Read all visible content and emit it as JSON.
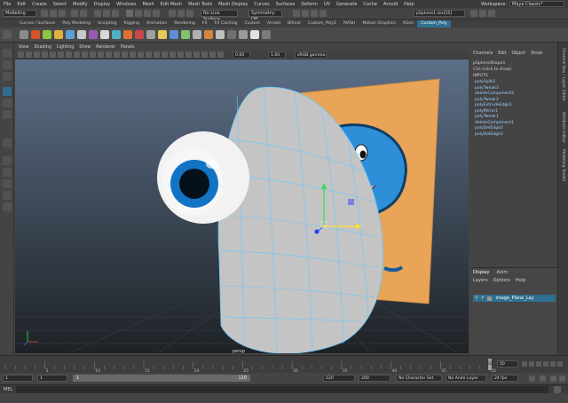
{
  "menubar": {
    "items": [
      "File",
      "Edit",
      "Create",
      "Select",
      "Modify",
      "Display",
      "Windows",
      "Mesh",
      "Edit Mesh",
      "Mesh Tools",
      "Mesh Display",
      "Curves",
      "Surfaces",
      "Deform",
      "UV",
      "Generate",
      "Cache",
      "Arnold",
      "Help"
    ],
    "workspace_label": "Workspace:",
    "workspace_value": "Maya Classic*"
  },
  "status": {
    "mode": "Modeling",
    "live_surface": "No Live Surface",
    "symmetry": "Symmetry: Off",
    "selection": "pSphere1.vtx[55]"
  },
  "shelf_tabs": {
    "items": [
      "Curves / Surfaces",
      "Poly Modeling",
      "Sculpting",
      "Rigging",
      "Animation",
      "Rendering",
      "FX",
      "FX Caching",
      "Custom",
      "Arnold",
      "Bifrost",
      "Custom_Poly1",
      "MASH",
      "Motion Graphics",
      "XGen",
      "Custom_Poly"
    ],
    "active_index": 15
  },
  "shelf_icon_colors": [
    "#8a8a8a",
    "#d8542c",
    "#8ec63f",
    "#e0b040",
    "#5aa0d8",
    "#c8c8c8",
    "#9b59b6",
    "#d8d8d8",
    "#4fb0c6",
    "#e07030",
    "#c84848",
    "#a0a0a0",
    "#e8c85a",
    "#5c8fd6",
    "#7fc16e",
    "#b0b0b0",
    "#d6863c",
    "#c0c0c0",
    "#707070",
    "#9c9c9c",
    "#e2e2e2",
    "#7a7a7a"
  ],
  "viewport": {
    "menu": [
      "View",
      "Shading",
      "Lighting",
      "Show",
      "Renderer",
      "Panels"
    ],
    "exposure": "0.00",
    "gamma": "1.00",
    "color_space": "sRGB gamma",
    "camera_label": "persp",
    "bg_top": "#5c6f88",
    "bg_bottom": "#1e2226",
    "mesh_color": "#c4c4c4",
    "wire_color": "#66c8ff",
    "plane_color": "#e9a458",
    "eye_iris_color": "#1274c4"
  },
  "channel_box": {
    "tabs": [
      "Channels",
      "Edit",
      "Object",
      "Show"
    ],
    "shape": "pSphereShape1",
    "cvs": "CVs (click to show)",
    "inputs_label": "INPUTS",
    "history": [
      "polySplit3",
      "polyTweak3",
      "deleteComponent2",
      "polyTweak2",
      "polyExtrudeEdge1",
      "polyMirror1",
      "polyTweak1",
      "deleteComponent1",
      "polyDelEdge2",
      "polyDelEdge1"
    ],
    "side_tabs": [
      "Channel Box / Layer Editor",
      "Attribute Editor",
      "Modeling Toolkit"
    ]
  },
  "layer_editor": {
    "tabs": [
      "Display",
      "Anim"
    ],
    "menu": [
      "Layers",
      "Options",
      "Help"
    ],
    "layer_v": "V",
    "layer_p": "P",
    "layer_name": "image_Plane_Lay"
  },
  "time_slider": {
    "ticks": [
      "5",
      "10",
      "15",
      "20",
      "25",
      "30",
      "35",
      "40",
      "45",
      "50"
    ],
    "current_frame": "50",
    "current_time_field": "50"
  },
  "range_slider": {
    "start": "1",
    "start2": "1",
    "range_start_label": "1",
    "range_end_label": "120",
    "end": "120",
    "end2": "200",
    "character_set": "No Character Set",
    "anim_layer": "No Anim Layer",
    "fps": "24 fps"
  },
  "command_line": {
    "label": "MEL"
  }
}
